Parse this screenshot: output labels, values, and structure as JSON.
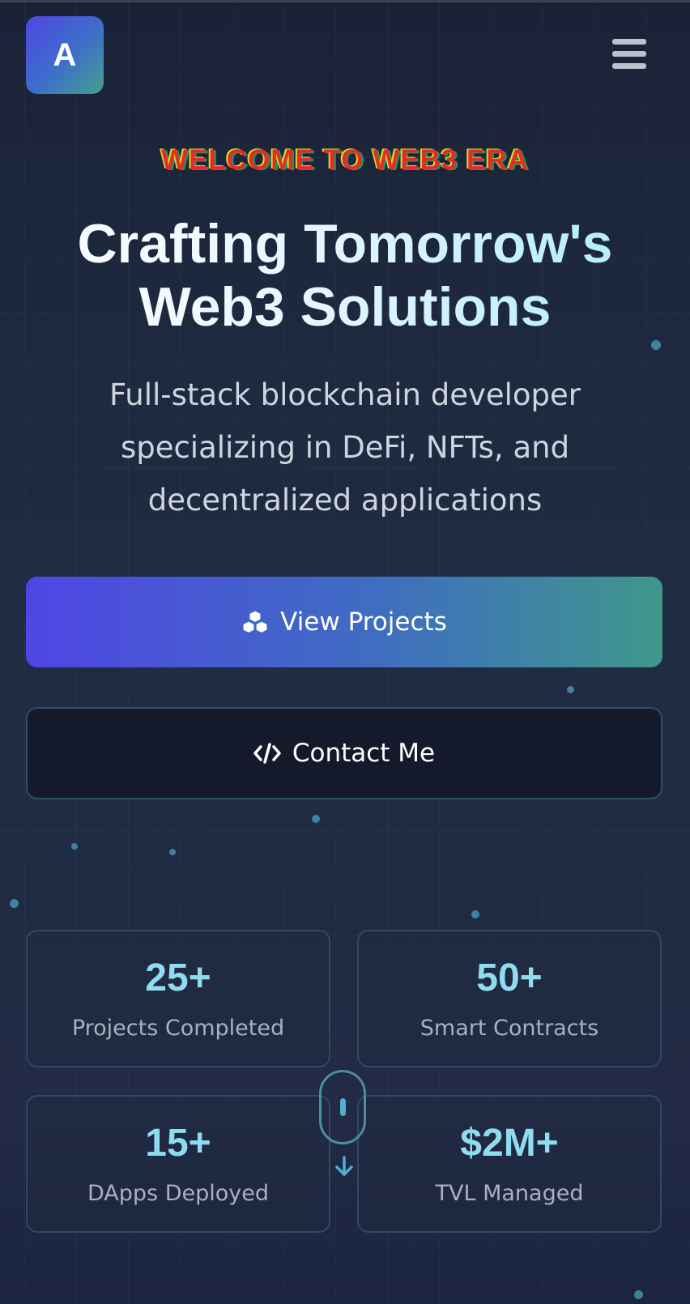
{
  "colors": {
    "background": "#1e2a40",
    "accent_indigo": "#4f46e5",
    "accent_teal": "#3f978b",
    "stat_number": "#8fdcf1",
    "eyebrow_text": "#e62a2a"
  },
  "header": {
    "logo_letter": "A",
    "menu_icon": "hamburger-menu-icon"
  },
  "hero": {
    "eyebrow": "WELCOME TO WEB3 ERA",
    "title_line1": "Crafting Tomorrow's",
    "title_line2": "Web3 Solutions",
    "subtitle": "Full-stack blockchain developer specializing in DeFi, NFTs, and decentralized applications"
  },
  "actions": {
    "primary": {
      "label": "View Projects",
      "icon": "cubes-icon"
    },
    "secondary": {
      "label": "Contact Me",
      "icon": "code-icon"
    }
  },
  "stats": [
    {
      "value": "25+",
      "label": "Projects Completed"
    },
    {
      "value": "50+",
      "label": "Smart Contracts"
    },
    {
      "value": "15+",
      "label": "DApps Deployed"
    },
    {
      "value": "$2M+",
      "label": "TVL Managed"
    }
  ],
  "scroll_indicator": {
    "icon": "mouse-scroll-icon",
    "arrow_icon": "arrow-down-icon"
  }
}
